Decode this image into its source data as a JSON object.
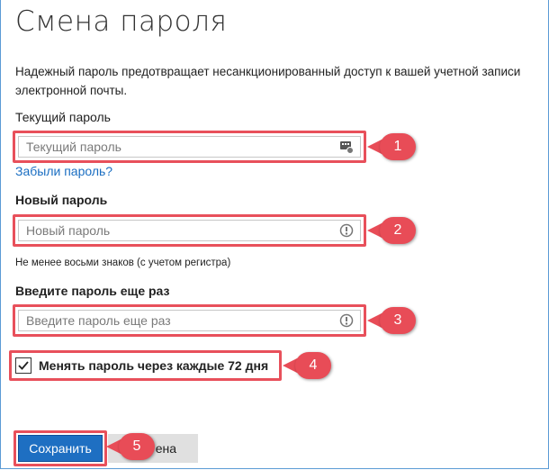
{
  "page": {
    "title": "Смена пароля",
    "description": "Надежный пароль предотвращает несанкционированный доступ к вашей учетной записи электронной почты."
  },
  "current_password": {
    "label": "Текущий пароль",
    "placeholder": "Текущий пароль",
    "forgot_link": "Забыли пароль?",
    "callout": "1"
  },
  "new_password": {
    "label": "Новый пароль",
    "placeholder": "Новый пароль",
    "hint": "Не менее восьми знаков (с учетом регистра)",
    "callout": "2"
  },
  "repeat_password": {
    "label": "Введите пароль еще раз",
    "placeholder": "Введите пароль еще раз",
    "callout": "3"
  },
  "expiry_option": {
    "label": "Менять пароль через каждые 72 дня",
    "checked": true,
    "callout": "4"
  },
  "actions": {
    "save_label": "Сохранить",
    "cancel_label": "ена",
    "callout": "5"
  },
  "colors": {
    "highlight": "#e8505b",
    "primary_button": "#1e6fc2",
    "link": "#1a6ec2",
    "frame_border": "#5b9bd5"
  }
}
